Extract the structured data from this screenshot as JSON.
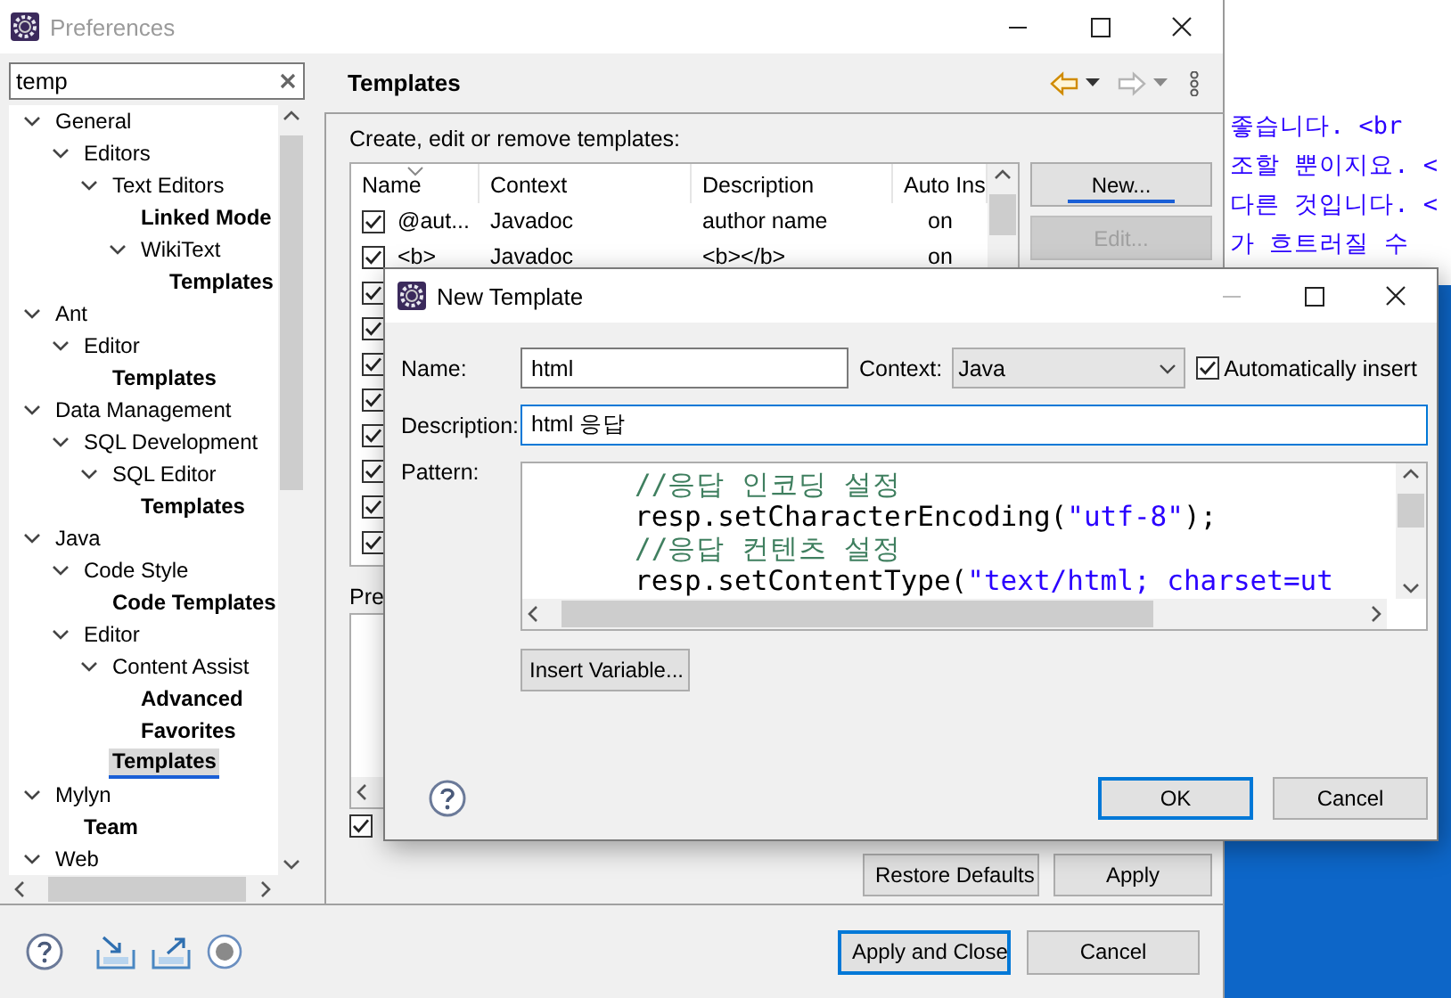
{
  "background_editor": {
    "lines": [
      "좋습니다. <br",
      "조할 뿐이지요. <",
      "다른 것입니다. <",
      "가 흐트러질 수"
    ]
  },
  "preferences": {
    "title": "Preferences",
    "filter": {
      "value": "temp"
    },
    "tree": [
      {
        "label": "General",
        "expanded": true,
        "selected": false,
        "children": [
          {
            "label": "Editors",
            "expanded": true,
            "selected": false,
            "children": [
              {
                "label": "Text Editors",
                "expanded": true,
                "selected": false,
                "children": [
                  {
                    "label": "Linked Mode",
                    "selected": false
                  },
                  {
                    "label": "WikiText",
                    "expanded": true,
                    "selected": false,
                    "children": [
                      {
                        "label": "Templates",
                        "selected": false
                      }
                    ]
                  }
                ]
              }
            ]
          }
        ]
      },
      {
        "label": "Ant",
        "expanded": true,
        "selected": false,
        "children": [
          {
            "label": "Editor",
            "expanded": true,
            "selected": false,
            "children": [
              {
                "label": "Templates",
                "selected": false
              }
            ]
          }
        ]
      },
      {
        "label": "Data Management",
        "expanded": true,
        "selected": false,
        "children": [
          {
            "label": "SQL Development",
            "expanded": true,
            "selected": false,
            "children": [
              {
                "label": "SQL Editor",
                "expanded": true,
                "selected": false,
                "children": [
                  {
                    "label": "Templates",
                    "selected": false
                  }
                ]
              }
            ]
          }
        ]
      },
      {
        "label": "Java",
        "expanded": true,
        "selected": false,
        "children": [
          {
            "label": "Code Style",
            "expanded": true,
            "selected": false,
            "children": [
              {
                "label": "Code Templates",
                "selected": false
              }
            ]
          },
          {
            "label": "Editor",
            "expanded": true,
            "selected": false,
            "children": [
              {
                "label": "Content Assist",
                "expanded": true,
                "selected": false,
                "children": [
                  {
                    "label": "Advanced",
                    "selected": false
                  },
                  {
                    "label": "Favorites",
                    "selected": false
                  }
                ]
              },
              {
                "label": "Templates",
                "selected": true
              }
            ]
          }
        ]
      },
      {
        "label": "Mylyn",
        "expanded": true,
        "selected": false,
        "children": [
          {
            "label": "Team",
            "selected": false
          }
        ]
      },
      {
        "label": "Web",
        "expanded": true,
        "selected": false
      }
    ],
    "page": {
      "title": "Templates",
      "description": "Create, edit or remove templates:",
      "table": {
        "columns": [
          "Name",
          "Context",
          "Description",
          "Auto Ins"
        ],
        "rows": [
          {
            "checked": true,
            "name": "@aut...",
            "context": "Javadoc",
            "description": "author name",
            "auto_insert": "on"
          },
          {
            "checked": true,
            "name": "<b>",
            "context": "Javadoc",
            "description": "<b></b>",
            "auto_insert": "on"
          },
          {
            "checked": true
          },
          {
            "checked": true
          },
          {
            "checked": true
          },
          {
            "checked": true
          },
          {
            "checked": true
          },
          {
            "checked": true
          },
          {
            "checked": true
          },
          {
            "checked": true
          }
        ]
      },
      "side_buttons": [
        {
          "label": "New...",
          "disabled": false,
          "focused": true
        },
        {
          "label": "Edit...",
          "disabled": true,
          "focused": false
        }
      ],
      "preview_label": "Pre",
      "use_formatter": {
        "checked": true
      },
      "buttons": [
        "Restore Defaults",
        "Apply"
      ]
    },
    "footer_buttons": [
      {
        "label": "Apply and Close",
        "default": true
      },
      {
        "label": "Cancel",
        "default": false
      }
    ]
  },
  "dialog": {
    "title": "New Template",
    "name": {
      "label": "Name:",
      "value": "html"
    },
    "context": {
      "label": "Context:",
      "value": "Java"
    },
    "auto_insert": {
      "label": "Automatically insert",
      "checked": true
    },
    "description": {
      "label": "Description:",
      "value": "html 응답",
      "focused": true
    },
    "pattern": {
      "label": "Pattern:",
      "lines": [
        [
          {
            "kind": "comment",
            "text": "//응답 인코딩 설정"
          }
        ],
        [
          {
            "kind": "code",
            "text": "resp.setCharacterEncoding("
          },
          {
            "kind": "string",
            "text": "\"utf-8\""
          },
          {
            "kind": "code",
            "text": ");"
          }
        ],
        [
          {
            "kind": "comment",
            "text": "//응답 컨텐츠 설정"
          }
        ],
        [
          {
            "kind": "code",
            "text": "resp.setContentType("
          },
          {
            "kind": "string",
            "text": "\"text/html; charset=ut"
          }
        ]
      ]
    },
    "insert_variable": "Insert Variable...",
    "buttons": [
      {
        "label": "OK",
        "default": true
      },
      {
        "label": "Cancel",
        "default": false
      }
    ]
  }
}
